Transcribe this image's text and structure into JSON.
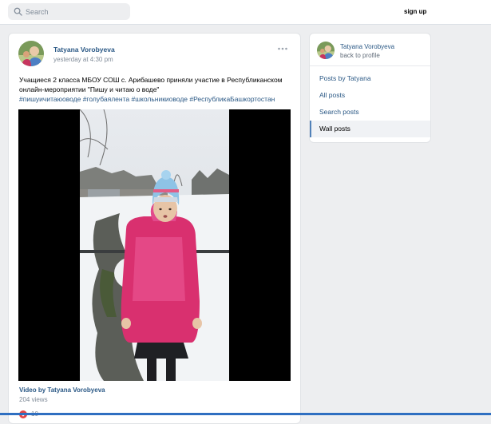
{
  "header": {
    "search_placeholder": "Search",
    "signup_label": "sign up"
  },
  "post": {
    "author": "Tatyana Vorobyeva",
    "time": "yesterday at 4:30 pm",
    "text_line1": "Учащиеся 2 класса МБОУ СОШ с. Арибашево приняли участие в Республиканском",
    "text_line2": "онлайн-мероприятии \"Пишу и читаю о воде\"",
    "hashtags": "#пишуичитаюоводе #голубаялента #школьникиоводе #РеспубликаБашкортостан",
    "video_caption": "Video by Tatyana Vorobyeva",
    "video_views": "204 views",
    "likes": "10",
    "more_icon": "ellipsis-icon",
    "like_icon": "heart-icon"
  },
  "sidebar": {
    "name": "Tatyana Vorobyeva",
    "back_label": "back to profile",
    "items": [
      {
        "label": "Posts by Tatyana",
        "active": false
      },
      {
        "label": "All posts",
        "active": false
      },
      {
        "label": "Search posts",
        "active": false
      },
      {
        "label": "Wall posts",
        "active": true
      }
    ]
  },
  "colors": {
    "link": "#2a5885",
    "accent": "#5181b8",
    "page_bg": "#edeef0",
    "muted": "#818c99"
  }
}
